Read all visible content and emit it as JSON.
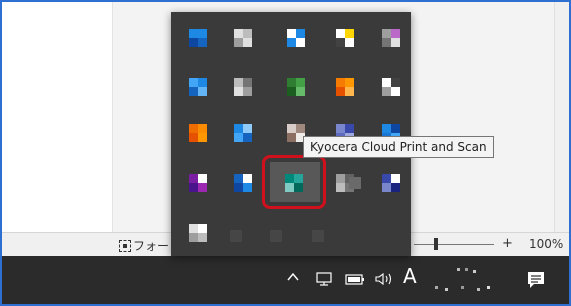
{
  "statusbar": {
    "focus_label": "フォー",
    "zoom_plus": "+",
    "zoom_level": "100%",
    "zoom_fraction": 0.25
  },
  "taskbar": {
    "ime_indicator": "A"
  },
  "flyout": {
    "tooltip": "Kyocera Cloud Print and Scan",
    "icons": [
      {
        "name": "tray-app-icon-1"
      },
      {
        "name": "tray-app-icon-2"
      },
      {
        "name": "tray-app-icon-3"
      },
      {
        "name": "tray-app-icon-4"
      },
      {
        "name": "tray-app-icon-5"
      },
      {
        "name": "tray-app-icon-6"
      },
      {
        "name": "tray-app-icon-7"
      },
      {
        "name": "tray-app-icon-8"
      },
      {
        "name": "tray-app-icon-9"
      },
      {
        "name": "tray-app-icon-10"
      },
      {
        "name": "tray-app-icon-11"
      },
      {
        "name": "tray-app-icon-12"
      },
      {
        "name": "tray-app-icon-13"
      },
      {
        "name": "tray-app-icon-14"
      },
      {
        "name": "tray-app-icon-15"
      },
      {
        "name": "tray-app-icon-16"
      },
      {
        "name": "tray-app-icon-17"
      },
      {
        "name": "kyocera-cloud-print-icon"
      },
      {
        "name": "tray-app-icon-19"
      },
      {
        "name": "tray-app-icon-20"
      },
      {
        "name": "printer-icon"
      }
    ]
  },
  "colors": {
    "highlight": "#d0101c",
    "taskbar": "#2b2b2b",
    "flyout": "#3a3a3a",
    "frame": "#2f6fd1"
  }
}
